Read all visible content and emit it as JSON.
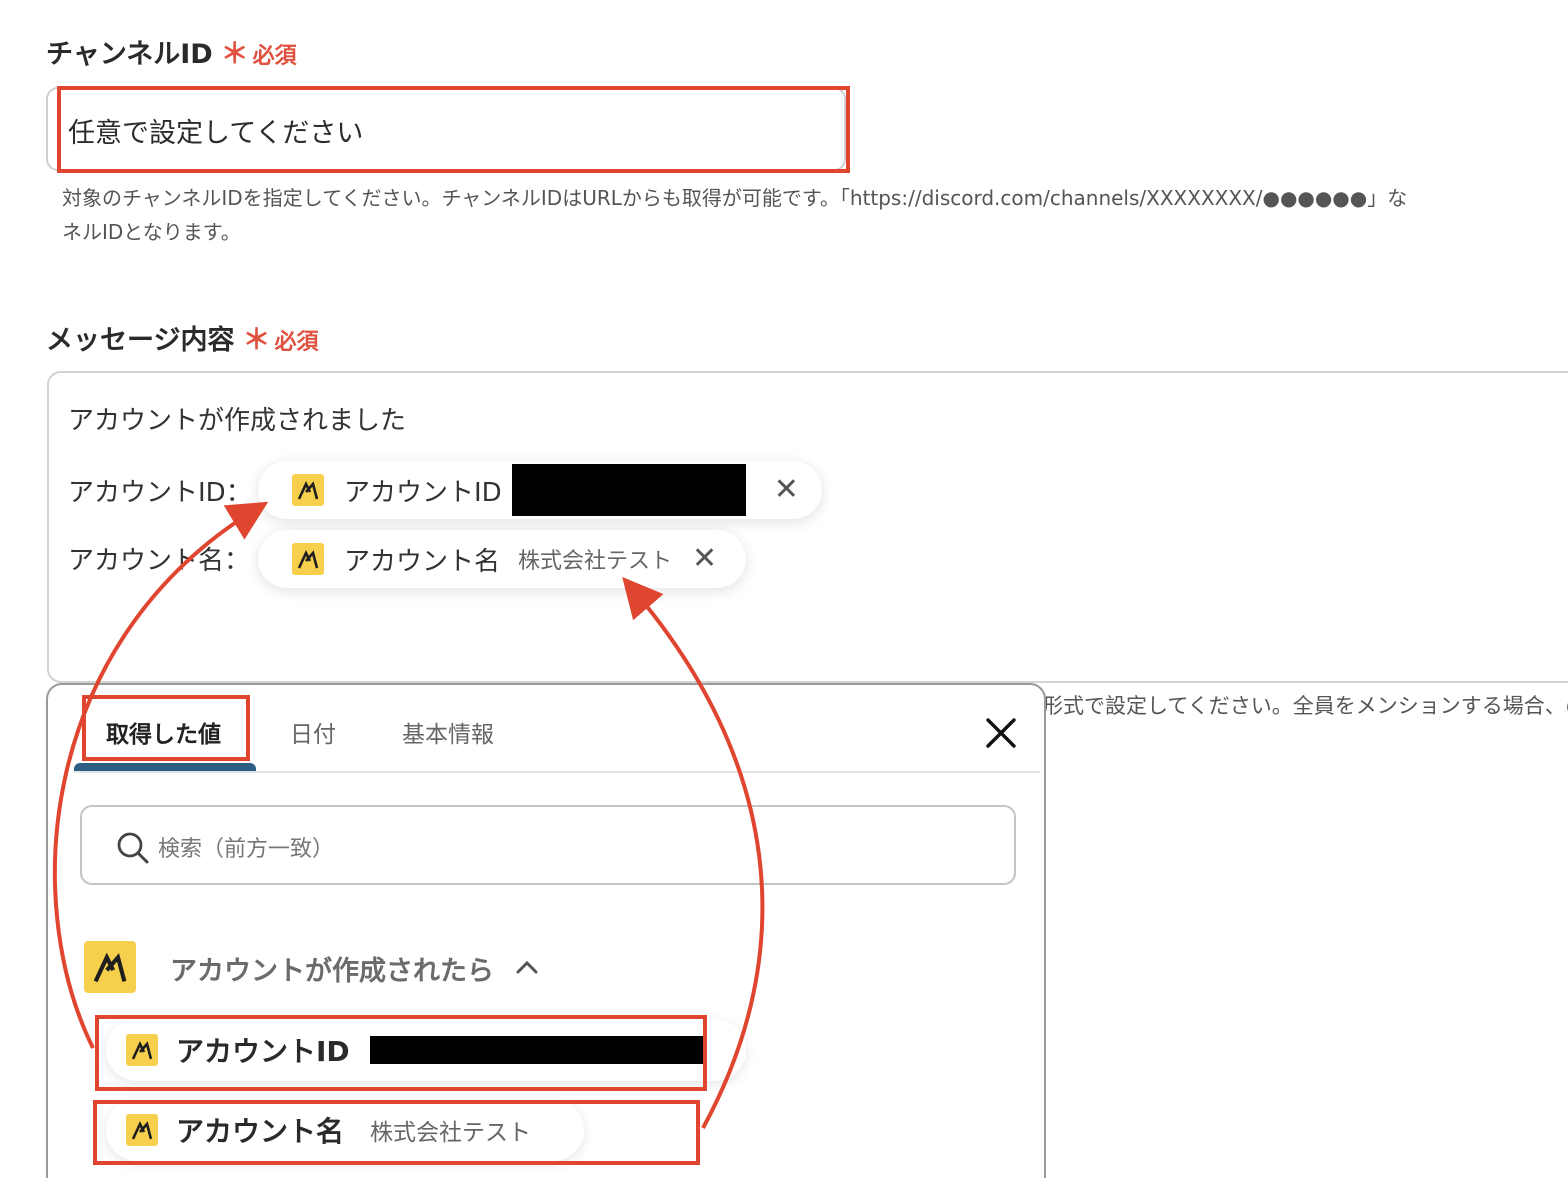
{
  "channel_id": {
    "label": "チャンネルID",
    "required_mark": "＊",
    "required_text": "必須",
    "value": "任意で設定してください",
    "help_line1": "対象のチャンネルIDを指定してください。チャンネルIDはURLからも取得が可能です。「https://discord.com/channels/XXXXXXXX/●●●●●●」な",
    "help_line2": "ネルIDとなります。"
  },
  "message": {
    "label": "メッセージ内容",
    "required_mark": "＊",
    "required_text": "必須",
    "line1": "アカウントが作成されました",
    "line2_prefix": "アカウントID：",
    "line3_prefix": "アカウント名：",
    "chips": [
      {
        "name": "アカウントID",
        "value": ""
      },
      {
        "name": "アカウント名",
        "value": "株式会社テスト"
      }
    ],
    "chip_close": "✕",
    "help_partial": "形式で設定してください。全員をメンションする場合、@"
  },
  "popup": {
    "tabs": [
      "取得した値",
      "日付",
      "基本情報"
    ],
    "active_tab": "取得した値",
    "search_placeholder": "検索（前方一致）",
    "group_title": "アカウントが作成されたら",
    "items": [
      {
        "name": "アカウントID",
        "value": ""
      },
      {
        "name": "アカウント名",
        "value": "株式会社テスト"
      }
    ]
  },
  "colors": {
    "accent_red": "#e0452f",
    "required_red": "#e0513f",
    "app_icon_yellow": "#f6d04d",
    "tab_underline": "#2d5e83"
  },
  "icons": {
    "app": "app-logo-icon",
    "close": "close-icon",
    "search": "search-icon",
    "chevron": "chevron-up-icon"
  }
}
